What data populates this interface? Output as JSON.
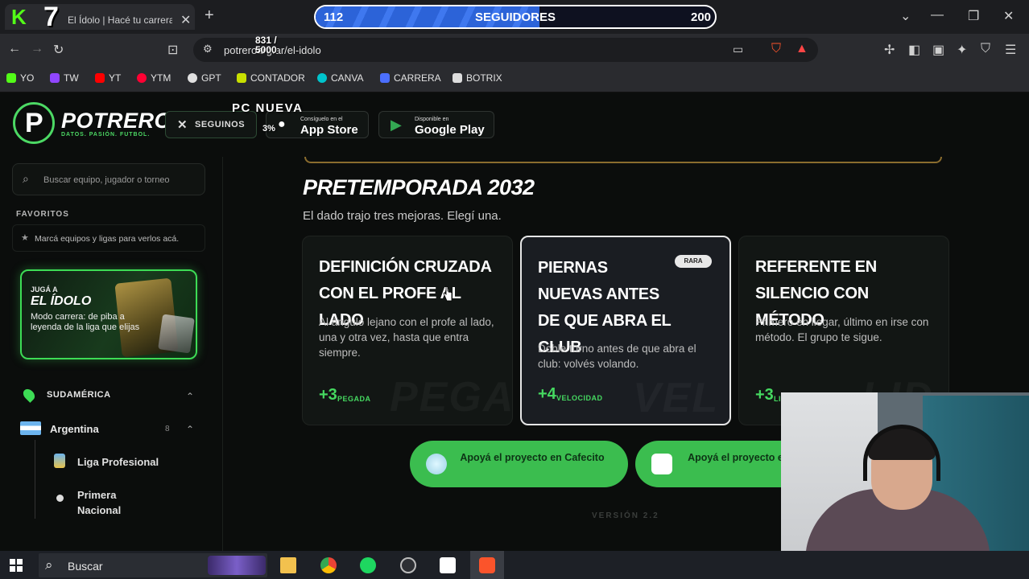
{
  "browser": {
    "tab_title": "El Ídolo | Hacé tu carrera de futbol",
    "tab_close": "✕",
    "new_tab": "+",
    "url": "potreroarg.ar/el-idolo",
    "bookmarks": [
      "YO",
      "TW",
      "YT",
      "YTM",
      "GPT",
      "CONTADOR",
      "CANVA",
      "CARRERA",
      "BOTRIX"
    ],
    "bookmark_colors": [
      "#53fc18",
      "#9146ff",
      "#ff0000",
      "#ff0033",
      "#e0e0e0",
      "#c8e000",
      "#00c4cc",
      "#4b6fff",
      "#dddddd"
    ]
  },
  "stream_overlay": {
    "kick_letter": "K",
    "seven": "7",
    "followers_current": "112",
    "followers_label": "SEGUIDORES",
    "followers_goal": "200",
    "followers_fraction": 0.56,
    "counter_line1": "831 /",
    "counter_line2": "5000",
    "pc_label": "PC NUEVA",
    "pc_percent": "3%"
  },
  "site": {
    "brand": "POTRERO",
    "tagline": "DATOS. PASIÓN. FUTBOL.",
    "follow_button": "SEGUINOS",
    "app_store_small": "Consíguelo en el",
    "app_store_big": "App Store",
    "google_small": "Disponible en",
    "google_big": "Google Play"
  },
  "sidebar": {
    "search_placeholder": "Buscar equipo, jugador o torneo",
    "favorites_title": "FAVORITOS",
    "favorites_hint": "Marcá equipos y ligas para verlos acá.",
    "promo_small": "JUGÁ A",
    "promo_big": "EL ÍDOLO",
    "promo_desc": "Modo carrera: de piba a leyenda de la liga que elijas",
    "region": "SUDAMÉRICA",
    "country": "Argentina",
    "country_count": "8",
    "leagues": [
      "Liga Profesional",
      "Primera Nacional"
    ]
  },
  "main": {
    "season_title": "PRETEMPORADA 2032",
    "season_sub": "El dado trajo tres mejoras. Elegí una.",
    "cards": [
      {
        "title": "DEFINICIÓN CRUZADA CON EL PROFE AL LADO",
        "desc": "Al ángulo lejano con el profe al lado, una y otra vez, hasta que entra siempre.",
        "bonus": "+3",
        "stat": "PEGADA",
        "watermark": "PEGADA",
        "badge": ""
      },
      {
        "title": "PIERNAS NUEVAS ANTES DE QUE ABRA EL CLUB",
        "desc": "Doble turno antes de que abra el club: volvés volando.",
        "bonus": "+4",
        "stat": "VELOCIDAD",
        "watermark": "VEL",
        "badge": "RARA"
      },
      {
        "title": "REFERENTE EN SILENCIO CON MÉTODO",
        "desc": "Primero en llegar, último en irse con método. El grupo te sigue.",
        "bonus": "+3",
        "stat": "LI",
        "watermark": "LID",
        "badge": ""
      }
    ],
    "support_cafecito": "Apoyá el proyecto en Cafecito",
    "support_kofi": "Apoyá el proyecto en Ko-Fi",
    "version": "VERSIÓN 2.2"
  },
  "taskbar": {
    "search": "Buscar"
  }
}
